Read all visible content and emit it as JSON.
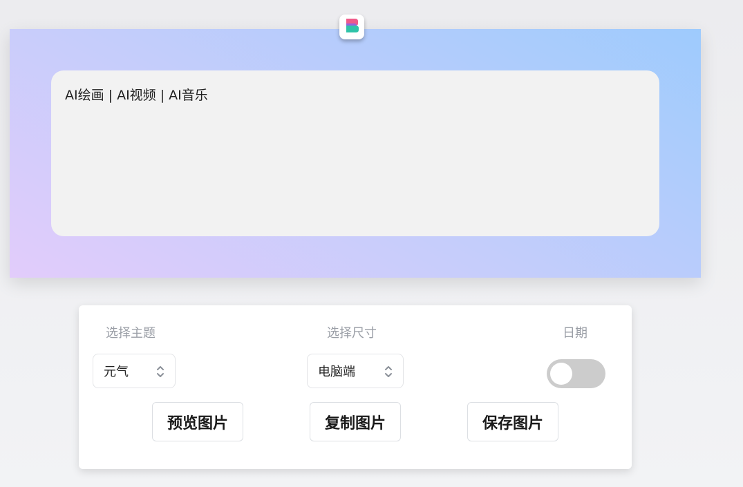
{
  "canvas": {
    "text": "AI绘画 | AI视频 | AI音乐",
    "gradient_colors": [
      "#e2ccfb",
      "#c5cdfb",
      "#9ecbfd"
    ]
  },
  "logo": {
    "icon": "brand-logo-icon",
    "colors": [
      "#ef5a8a",
      "#8b62e8",
      "#2fc3a8"
    ]
  },
  "controls": {
    "theme": {
      "label": "选择主题",
      "value": "元气"
    },
    "size": {
      "label": "选择尺寸",
      "value": "电脑端"
    },
    "date": {
      "label": "日期",
      "enabled": false
    },
    "buttons": {
      "preview": "预览图片",
      "copy": "复制图片",
      "save": "保存图片"
    }
  }
}
